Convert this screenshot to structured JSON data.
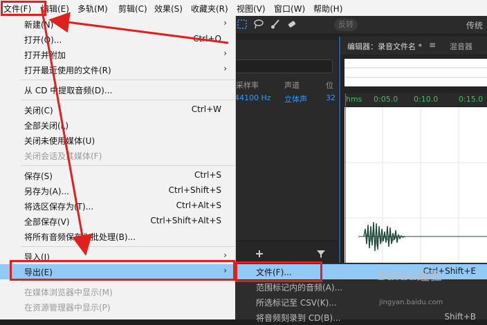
{
  "menubar": {
    "items": [
      "文件(F)",
      "编辑(E)",
      "多轨(M)",
      "剪辑(C)",
      "效果(S)",
      "收藏夹(R)",
      "视图(V)",
      "窗口(W)",
      "帮助(H)"
    ]
  },
  "toolbar": {
    "reverse_label": "反转",
    "right_label": "传统"
  },
  "files_panel": {
    "columns": [
      "采样率",
      "声道",
      "位"
    ],
    "row": [
      "44100 Hz",
      "立体声",
      "32"
    ]
  },
  "editor": {
    "tab_label": "编辑器：录音文件名 *",
    "mixer_tab_label": "混音器",
    "ruler": [
      "hms",
      "0:05.0",
      "0:10.0",
      "0:15.0"
    ]
  },
  "file_menu": {
    "items": [
      {
        "label": "新建(N)",
        "shortcut": "",
        "submenu": true,
        "disabled": false
      },
      {
        "label": "打开(O)...",
        "shortcut": "Ctrl+O",
        "submenu": false,
        "disabled": false
      },
      {
        "label": "打开并附加",
        "shortcut": "",
        "submenu": true,
        "disabled": false
      },
      {
        "label": "打开最近使用的文件(R)",
        "shortcut": "",
        "submenu": true,
        "disabled": false
      },
      {
        "label": "从 CD 中提取音频(D)...",
        "shortcut": "",
        "submenu": false,
        "disabled": false
      },
      {
        "label": "关闭(C)",
        "shortcut": "Ctrl+W",
        "submenu": false,
        "disabled": false
      },
      {
        "label": "全部关闭(L)",
        "shortcut": "",
        "submenu": false,
        "disabled": false
      },
      {
        "label": "关闭未使用媒体(U)",
        "shortcut": "",
        "submenu": false,
        "disabled": false
      },
      {
        "label": "关闭会话及其媒体(F)",
        "shortcut": "",
        "submenu": false,
        "disabled": true
      },
      {
        "label": "保存(S)",
        "shortcut": "Ctrl+S",
        "submenu": false,
        "disabled": false
      },
      {
        "label": "另存为(A)...",
        "shortcut": "Ctrl+Shift+S",
        "submenu": false,
        "disabled": false
      },
      {
        "label": "将选区保存为(T)...",
        "shortcut": "Ctrl+Alt+S",
        "submenu": false,
        "disabled": false
      },
      {
        "label": "全部保存(V)",
        "shortcut": "Ctrl+Shift+Alt+S",
        "submenu": false,
        "disabled": false
      },
      {
        "label": "将所有音频保存为批处理(B)...",
        "shortcut": "",
        "submenu": false,
        "disabled": false
      },
      {
        "label": "导入(I)",
        "shortcut": "",
        "submenu": true,
        "disabled": false
      },
      {
        "label": "导出(E)",
        "shortcut": "",
        "submenu": true,
        "disabled": false
      },
      {
        "label": "在媒体浏览器中显示(M)",
        "shortcut": "",
        "submenu": false,
        "disabled": true
      },
      {
        "label": "在资源管理器中显示(P)",
        "shortcut": "",
        "submenu": false,
        "disabled": true
      }
    ]
  },
  "export_submenu": {
    "items": [
      {
        "label": "文件(F)...",
        "shortcut": "Ctrl+Shift+E"
      },
      {
        "label": "范围标记内的音频(A)...",
        "shortcut": ""
      },
      {
        "label": "所选标记至 CSV(K)...",
        "shortcut": ""
      },
      {
        "label": "将音频刻录到 CD(B)...",
        "shortcut": "Shift+B"
      }
    ]
  },
  "watermark": {
    "text": "Baidu经验",
    "sub": "jingyan.baidu.com"
  },
  "colors": {
    "highlight": "#91c9f7",
    "annotation": "#e0201c",
    "waveform": "#1e4a3a",
    "accent_blue": "#2f9bff",
    "ruler_green": "#3dbf6a"
  }
}
